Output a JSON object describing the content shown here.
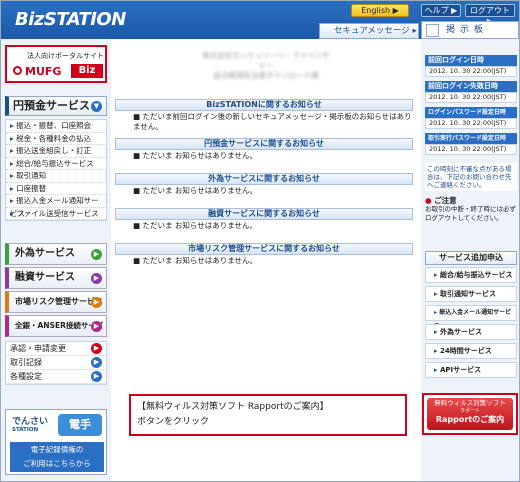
{
  "header": {
    "logo": "BizSTATION",
    "english": "English ▶",
    "help": "ヘルプ ▶",
    "logout": "ログアウト ▶",
    "security_message": "セキュアメッセージ ▸",
    "bulletin": "掲示板"
  },
  "left": {
    "portal_caption": "法人向けポータルサイト",
    "portal_brand": "MUFG",
    "portal_biz": "Biz",
    "yen_header": "円預金サービス",
    "yen_items": [
      "振込・振替、口座照会",
      "税金・各種料金の払込",
      "振込送金組戻し・訂正",
      "総合/給与振込サービス",
      "取引通知",
      "口座振替",
      "振込入金メール通知サービス",
      "ファイル送受信サービス"
    ],
    "foreign": "外為サービス",
    "finance": "融資サービス",
    "market": "市場リスク管理サービス",
    "anser": "全銀・ANSER接続サービス",
    "sub_items": [
      "承認・申請変更",
      "取引記録",
      "各種設定"
    ],
    "densai": {
      "logo": "でんさい",
      "station": "STATION",
      "button": "電手",
      "caption1": "電子記録債権の",
      "caption2": "ご利用はこちらから"
    }
  },
  "center": {
    "address_lines": [
      "株式会社モンテッソーリ・アドベンチャー",
      "総合経理担当者ダウンロード様"
    ],
    "sections": [
      {
        "title": "BizSTATIONに関するお知らせ",
        "body": "ただいま前回ログイン後の新しいセキュアメッセージ・掲示板のお知らせはありません。"
      },
      {
        "title": "円預金サービスに関するお知らせ",
        "body": "ただいま お知らせはありません。"
      },
      {
        "title": "外為サービスに関するお知らせ",
        "body": "ただいま お知らせはありません。"
      },
      {
        "title": "融資サービスに関するお知らせ",
        "body": "ただいま お知らせはありません。"
      },
      {
        "title": "市場リスク管理サービスに関するお知らせ",
        "body": "ただいま お知らせはありません。"
      }
    ],
    "callout_line1": "【無料ウィルス対策ソフト Rapportのご案内】",
    "callout_line2": "ボタンをクリック"
  },
  "right": {
    "login": [
      {
        "label": "前回ログイン日時",
        "value": "2012. 10. 30  22:00(JST)"
      },
      {
        "label": "前回ログイン失敗日時",
        "value": "2012. 10. 30  22:00(JST)"
      },
      {
        "label": "ログインパスワード設定日時",
        "value": "2012. 10. 30  22:00(JST)"
      },
      {
        "label": "取引実行パスワード設定日時",
        "value": "2012. 10. 30  22:00(JST)"
      }
    ],
    "note": "この時刻に不審な点がある場合は、下記のお問い合わせ先へご連絡ください。",
    "caution_title": "ご注意",
    "caution_body": "お取引の中断・終了時には必ずログアウトしてください。",
    "service_header": "サービス追加申込",
    "services": [
      "総合/給与振込サービス",
      "取引通知サービス",
      "振込入金メール通知サービス",
      "外為サービス",
      "24時間サービス",
      "APIサービス"
    ],
    "rapport_top": "無料ウィルス対策ソフト",
    "rapport_sub": "ラポート",
    "rapport_main": "Rapportのご案内"
  },
  "colors": {
    "brand_blue": "#1c58a8",
    "mufg_red": "#d0021b",
    "highlight": "#d0021b"
  }
}
